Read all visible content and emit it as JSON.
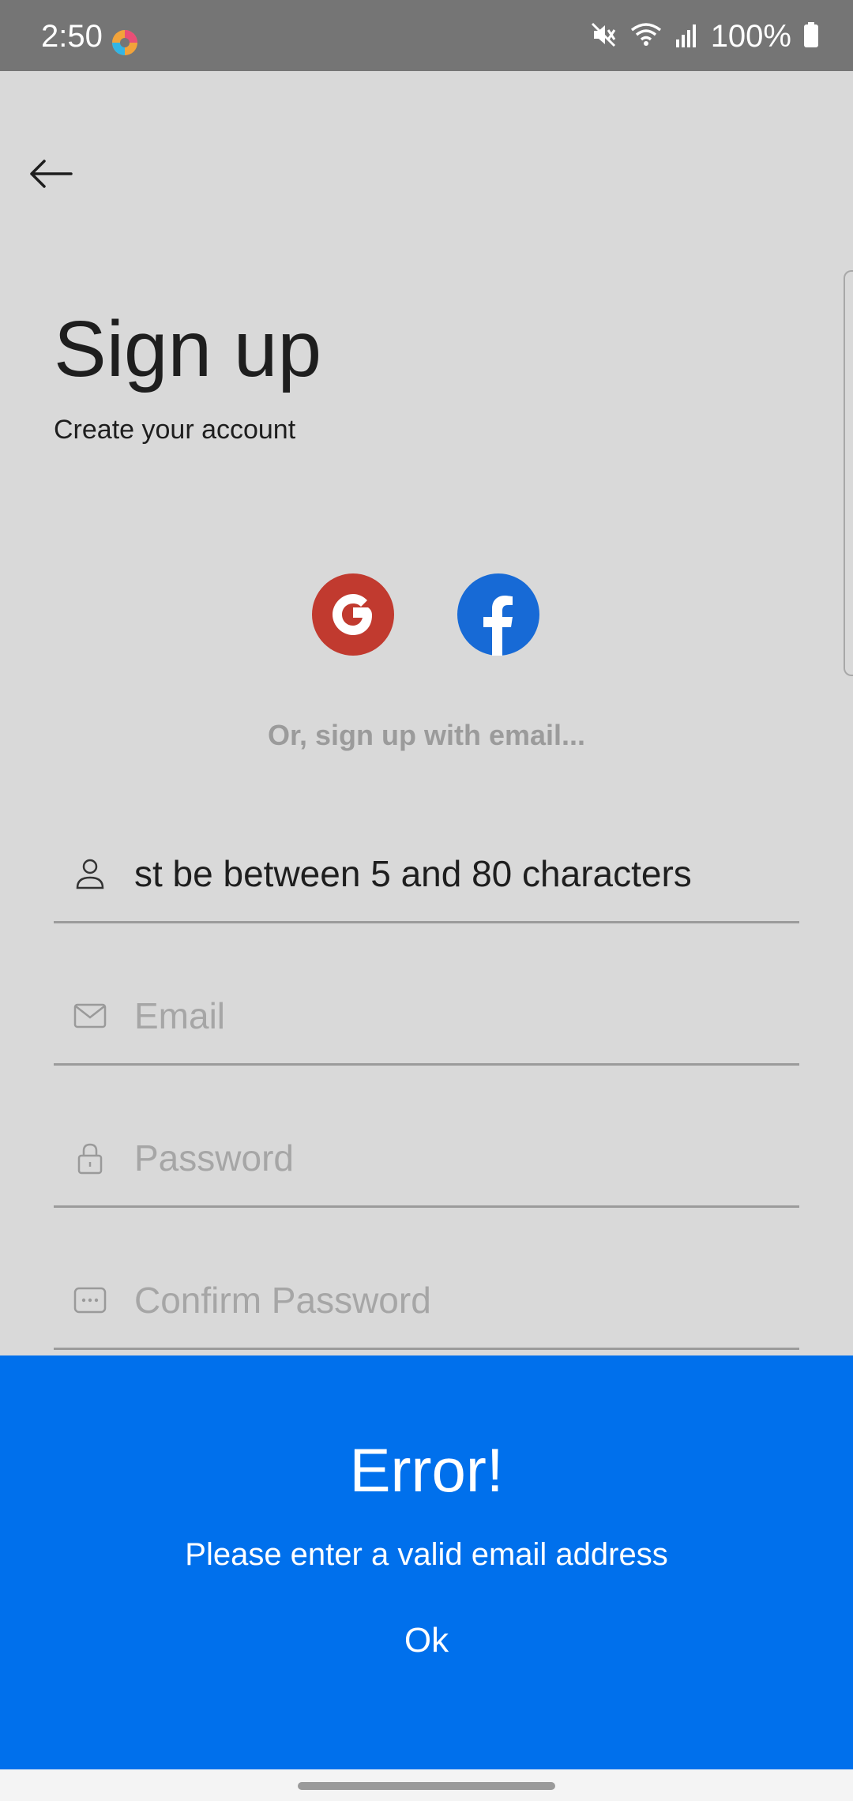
{
  "status_bar": {
    "time": "2:50",
    "battery": "100%",
    "icons": [
      "app-icon",
      "mute-icon",
      "wifi-icon",
      "signal-icon",
      "battery-icon"
    ]
  },
  "header": {
    "back_icon": "arrow-left-icon"
  },
  "page": {
    "title": "Sign up",
    "subtitle": "Create your account"
  },
  "social": {
    "google_icon": "google-icon",
    "facebook_icon": "facebook-icon",
    "google_color": "#c13a2f",
    "facebook_color": "#176ad6"
  },
  "divider_text": "Or, sign up with email...",
  "form": {
    "name": {
      "value": "st be between 5 and 80 characters",
      "icon": "user-icon"
    },
    "email": {
      "placeholder": "Email",
      "icon": "mail-icon"
    },
    "password": {
      "placeholder": "Password",
      "icon": "lock-icon"
    },
    "confirm_password": {
      "placeholder": "Confirm Password",
      "icon": "password-dots-icon"
    }
  },
  "dialog": {
    "title": "Error!",
    "message": "Please enter a valid email address",
    "ok_label": "Ok",
    "background": "#0070ec"
  },
  "colors": {
    "background": "#d9d9d9",
    "status_bar": "#757575"
  }
}
